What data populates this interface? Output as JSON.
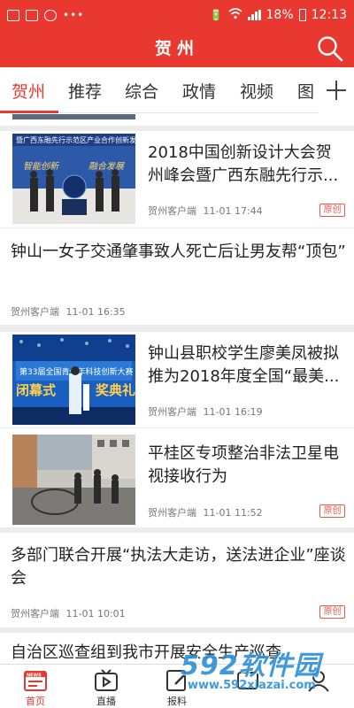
{
  "status_bar": {
    "battery": "18%",
    "time": "12:13"
  },
  "header": {
    "title": "贺州"
  },
  "tabs": [
    "贺州",
    "推荐",
    "综合",
    "政情",
    "视频",
    "图"
  ],
  "articles": [
    {
      "title": "2018中国创新设计大会贺州峰会暨广西东融先行示...",
      "source": "贺州客户端",
      "time": "11-01 17:44",
      "tag": "原创"
    },
    {
      "title": "钟山一女子交通肇事致人死亡后让男友帮“顶包”",
      "source": "贺州客户端",
      "time": "11-01 16:35"
    },
    {
      "title": "钟山县职校学生廖美凤被拟推为2018年度全国“最美...",
      "source": "贺州客户端",
      "time": "11-01 16:19"
    },
    {
      "title": "平桂区专项整治非法卫星电视接收行为",
      "source": "贺州客户端",
      "time": "11-01 11:52",
      "tag": "原创"
    },
    {
      "title": "多部门联合开展“执法大走访，送法进企业”座谈会",
      "source": "贺州客户端",
      "time": "11-01 10:01",
      "tag": "原创"
    },
    {
      "title": "自治区巡查组到我市开展安全生产巡查"
    }
  ],
  "bottom_nav": [
    {
      "label": "首页",
      "icon": "news-icon"
    },
    {
      "label": "直播",
      "icon": "tv-icon"
    },
    {
      "label": "报料",
      "icon": "pen-icon"
    },
    {
      "label": "",
      "icon": "service-icon"
    },
    {
      "label": "",
      "icon": "user-icon"
    }
  ],
  "watermark": {
    "logo": "592软件园",
    "url": "www.592xiazai.com"
  },
  "colors": {
    "brand": "#e8382f",
    "tag": "#e8584f",
    "watermark": "#2b8fd8"
  }
}
